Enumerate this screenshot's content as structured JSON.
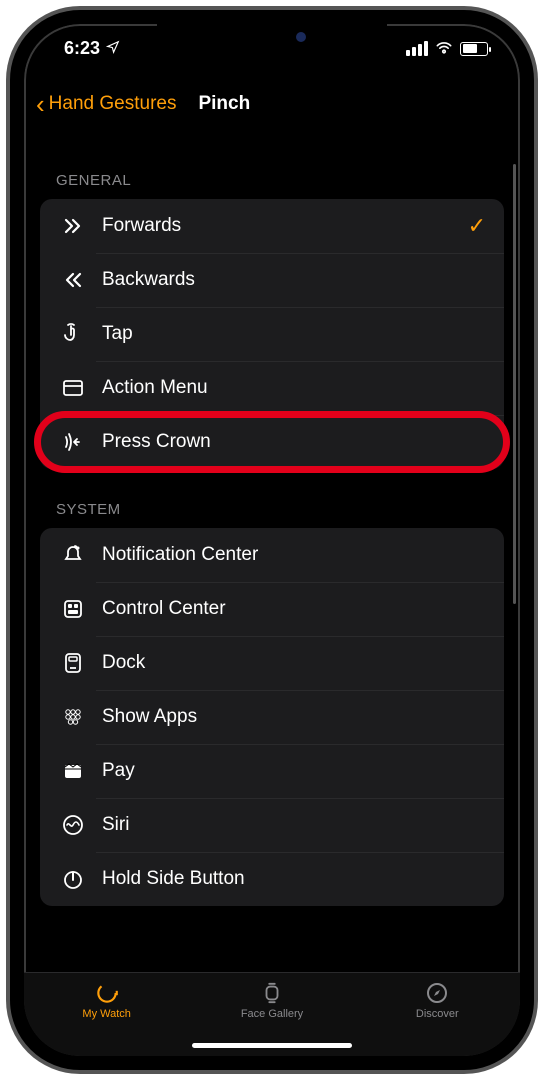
{
  "status": {
    "time": "6:23"
  },
  "nav": {
    "back_label": "Hand Gestures",
    "title": "Pinch"
  },
  "sections": {
    "general": {
      "header": "GENERAL",
      "items": {
        "forwards": "Forwards",
        "backwards": "Backwards",
        "tap": "Tap",
        "action_menu": "Action Menu",
        "press_crown": "Press Crown"
      }
    },
    "system": {
      "header": "SYSTEM",
      "items": {
        "notification_center": "Notification Center",
        "control_center": "Control Center",
        "dock": "Dock",
        "show_apps": "Show Apps",
        "pay": "Pay",
        "siri": "Siri",
        "hold_side_button": "Hold Side Button"
      }
    }
  },
  "tabs": {
    "my_watch": "My Watch",
    "face_gallery": "Face Gallery",
    "discover": "Discover"
  }
}
